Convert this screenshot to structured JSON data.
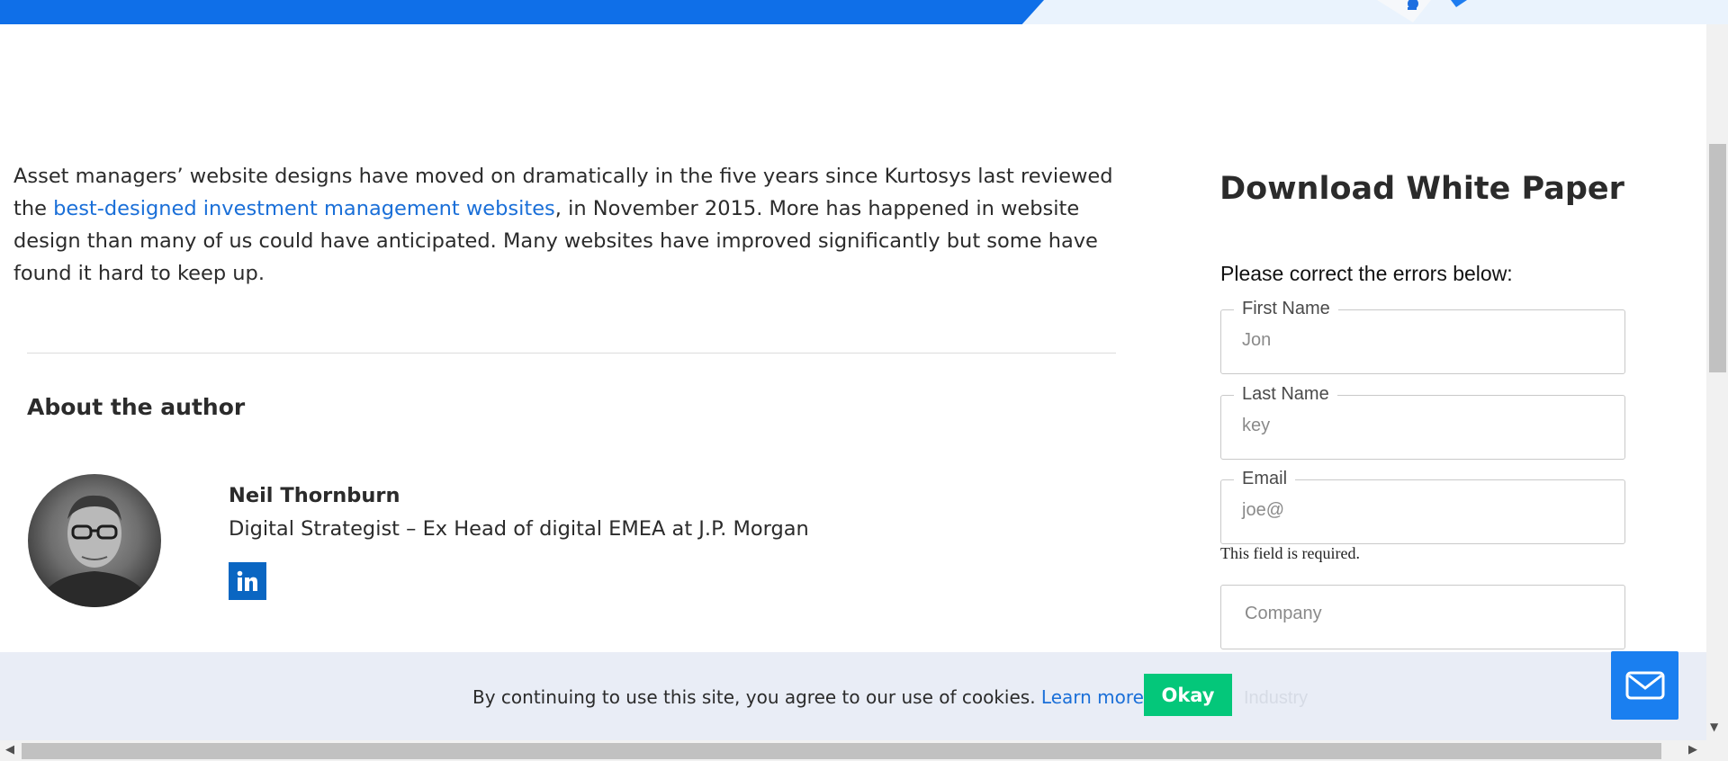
{
  "article": {
    "text_before": "Asset managers’ website designs have moved on dramatically in the five years since Kurtosys last reviewed the ",
    "link_text": "best-designed investment management websites",
    "text_after": ", in November 2015. More has happened in website design than many of us could have anticipated. Many websites have improved significantly but some have found it hard to keep up."
  },
  "about": {
    "title": "About the author",
    "name": "Neil Thornburn",
    "role": "Digital Strategist – Ex Head of digital EMEA at J.P. Morgan",
    "social_icon": "linkedin-icon"
  },
  "form": {
    "title": "Download White Paper",
    "error_message": "Please correct the errors below:",
    "fields": [
      {
        "label": "First Name",
        "value": "Jon"
      },
      {
        "label": "Last Name",
        "value": "key"
      },
      {
        "label": "Email",
        "value": "joe@"
      },
      {
        "label": "",
        "placeholder": "Company"
      }
    ],
    "email_error": "This field is required.",
    "next_field_placeholder": "Industry"
  },
  "cookie_bar": {
    "text": "By continuing to use this site, you agree to our use of cookies.",
    "link": "Learn more.",
    "button": "Okay"
  },
  "colors": {
    "brand_blue": "#0f6fe8",
    "link_blue": "#1a6fd8",
    "okay_green": "#04c77a",
    "linkedin_blue": "#0a66c2"
  },
  "icons": {
    "chat": "mail-icon"
  }
}
